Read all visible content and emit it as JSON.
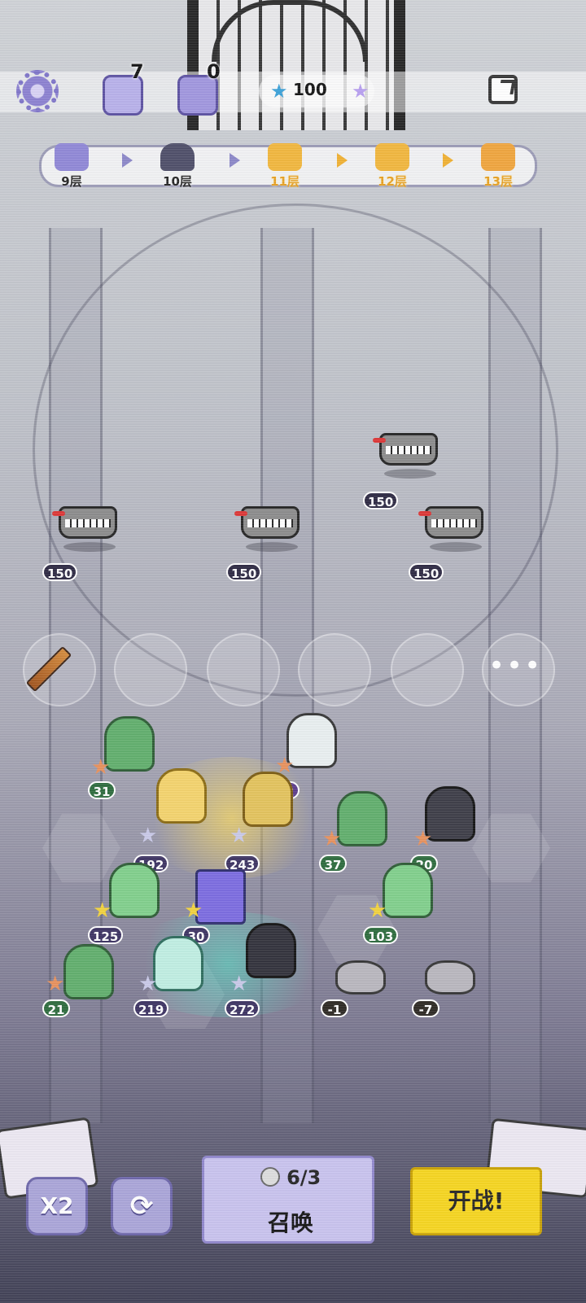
{
  "top_bar": {
    "resource_1": {
      "icon": "potion-flask-icon",
      "value": "7"
    },
    "resource_2": {
      "icon": "treasure-chest-icon",
      "value": "0"
    },
    "stars": {
      "icon": "blue-star-icon",
      "value": "100"
    }
  },
  "level_track": {
    "levels": [
      {
        "label": "9层",
        "icon": "goblet-icon",
        "state": "passed"
      },
      {
        "label": "10层",
        "icon": "horned-helmet-icon",
        "state": "current"
      },
      {
        "label": "11层",
        "icon": "crossed-swords-icon",
        "state": "upcoming"
      },
      {
        "label": "12层",
        "icon": "crossed-swords-icon",
        "state": "upcoming"
      },
      {
        "label": "13层",
        "icon": "treasure-chest-icon",
        "state": "upcoming"
      }
    ]
  },
  "enemies": [
    {
      "name": "mimic-bus",
      "hp": "150"
    },
    {
      "name": "mimic-bus",
      "hp": "150"
    },
    {
      "name": "mimic-bus",
      "hp": "150"
    },
    {
      "name": "mimic-bus",
      "hp": "150"
    }
  ],
  "bench": {
    "slot_1_item": "sword-icon",
    "more_label": "•••"
  },
  "units": [
    {
      "value": "31",
      "star": "bronze"
    },
    {
      "value": "12",
      "star": "bronze"
    },
    {
      "value": "192",
      "star": "silver"
    },
    {
      "value": "243",
      "star": "silver"
    },
    {
      "value": "37",
      "star": "bronze"
    },
    {
      "value": "20",
      "star": "bronze"
    },
    {
      "value": "125",
      "star": "gold"
    },
    {
      "value": "30",
      "star": "gold"
    },
    {
      "value": "103",
      "star": "gold"
    },
    {
      "value": "21",
      "star": "bronze"
    },
    {
      "value": "219",
      "star": "silver"
    },
    {
      "value": "272",
      "star": "silver"
    },
    {
      "value": "-1",
      "star": "none"
    },
    {
      "value": "-7",
      "star": "none"
    }
  ],
  "controls": {
    "speed_label": "X2",
    "refresh_icon": "refresh-icon",
    "summon_count": "6/3",
    "summon_label": "召唤",
    "fight_label": "开战!"
  },
  "colors": {
    "accent_purple": "#a9a4d8",
    "fight_yellow": "#f6d51c",
    "gold_level": "#e8a020"
  }
}
